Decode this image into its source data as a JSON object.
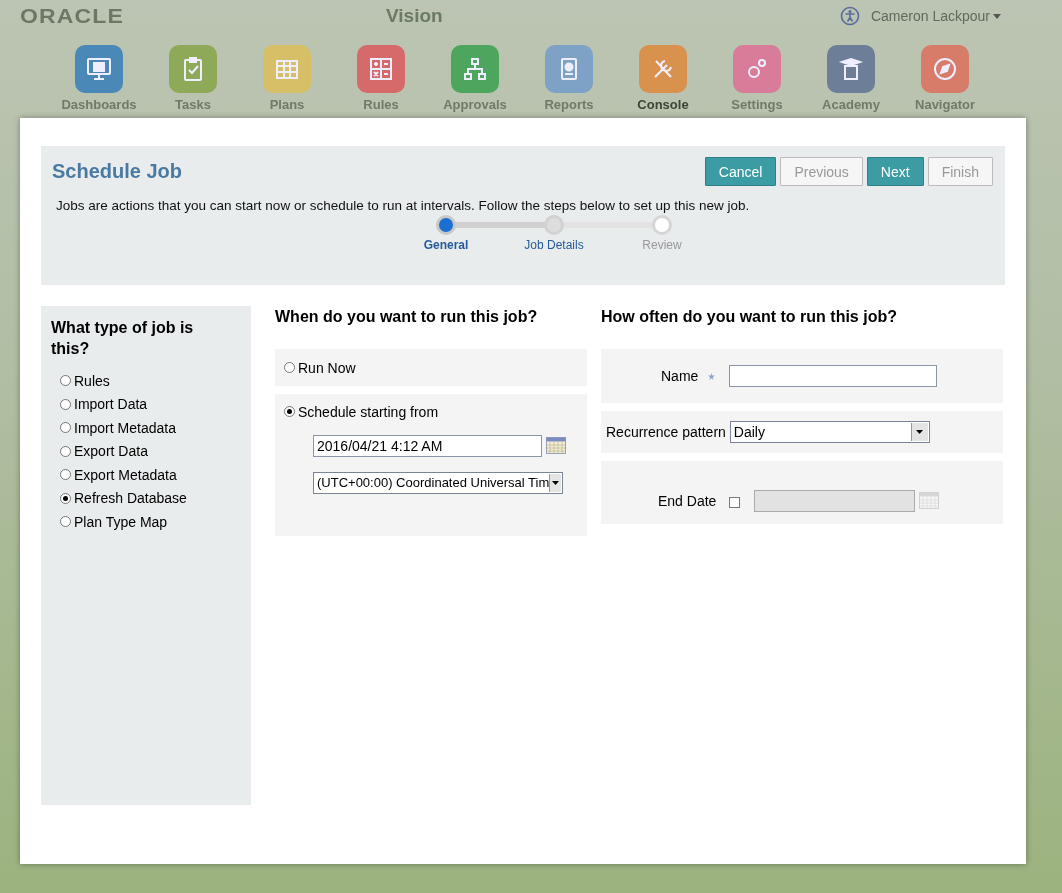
{
  "top_bar": {
    "logo": "ORACLE",
    "app_title": "Vision",
    "user": "Cameron Lackpour"
  },
  "nav": [
    {
      "label": "Dashboards",
      "selected": false,
      "color": "#4a88b8"
    },
    {
      "label": "Tasks",
      "selected": false,
      "color": "#8eaa58"
    },
    {
      "label": "Plans",
      "selected": false,
      "color": "#d6bf66"
    },
    {
      "label": "Rules",
      "selected": false,
      "color": "#d66a6a"
    },
    {
      "label": "Approvals",
      "selected": false,
      "color": "#4ea65e"
    },
    {
      "label": "Reports",
      "selected": false,
      "color": "#7ea2c6"
    },
    {
      "label": "Console",
      "selected": true,
      "color": "#d8924e"
    },
    {
      "label": "Settings",
      "selected": false,
      "color": "#d87c9a"
    },
    {
      "label": "Academy",
      "selected": false,
      "color": "#6c7e98"
    },
    {
      "label": "Navigator",
      "selected": false,
      "color": "#d87c6a"
    }
  ],
  "dialog": {
    "title": "Schedule Job",
    "buttons": [
      {
        "label": "Cancel",
        "kind": "primary",
        "disabled": false
      },
      {
        "label": "Previous",
        "kind": "secondary",
        "disabled": true
      },
      {
        "label": "Next",
        "kind": "primary",
        "disabled": false
      },
      {
        "label": "Finish",
        "kind": "secondary",
        "disabled": true
      }
    ],
    "description": "Jobs are actions that you can start now or schedule to run at intervals. Follow the steps below to set up this new job.",
    "steps": [
      {
        "label": "General",
        "selected": true,
        "disabled": false
      },
      {
        "label": "Job Details",
        "selected": false,
        "disabled": false
      },
      {
        "label": "Review",
        "selected": false,
        "disabled": true
      }
    ],
    "job_type": {
      "title": "What type of job is this?",
      "options": [
        {
          "label": "Rules",
          "selected": false
        },
        {
          "label": "Import Data",
          "selected": false
        },
        {
          "label": "Import Metadata",
          "selected": false
        },
        {
          "label": "Export Data",
          "selected": false
        },
        {
          "label": "Export Metadata",
          "selected": false
        },
        {
          "label": "Refresh Database",
          "selected": true
        },
        {
          "label": "Plan Type Map",
          "selected": false
        }
      ]
    },
    "when": {
      "title": "When do you want to run this job?",
      "run_now": {
        "label": "Run Now",
        "selected": false
      },
      "schedule": {
        "label": "Schedule starting from",
        "selected": true,
        "start_date": "2016/04/21 4:12 AM",
        "timezone": "(UTC+00:00) Coordinated Universal Tim"
      }
    },
    "how_often": {
      "title": "How often do you want to run this job?",
      "name": {
        "label": "Name",
        "required": true
      },
      "recurrence": {
        "label": "Recurrence pattern",
        "value": "Daily"
      },
      "end_date": {
        "label": "End Date",
        "checked": false,
        "disabled": true
      }
    }
  }
}
